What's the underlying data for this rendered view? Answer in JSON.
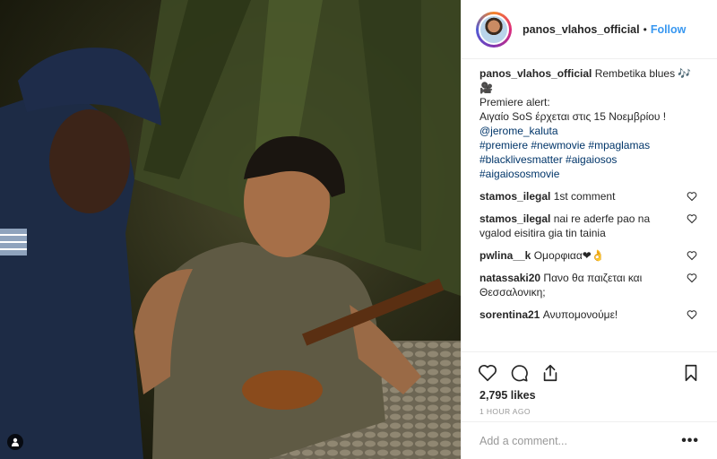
{
  "post": {
    "username": "panos_vlahos_official",
    "follow_label": "Follow",
    "separator": "•"
  },
  "caption": {
    "username": "panos_vlahos_official",
    "line1": "Rembetika blues 🎶🎥",
    "line2": "Premiere alert:",
    "line3": "Αιγαίο SoS έρχεται στις 15 Νοεμβρίου !",
    "mention": "@jerome_kaluta",
    "tags": [
      "#premiere",
      "#newmovie",
      "#mpaglamas",
      "#blacklivesmatter",
      "#aigaiosos",
      "#aigaiososmovie"
    ]
  },
  "comments": [
    {
      "user": "stamos_ilegal",
      "text": "1st comment"
    },
    {
      "user": "stamos_ilegal",
      "text": "nai re aderfe pao na vgalod eisitira gia tin tainia"
    },
    {
      "user": "pwlina__k",
      "text": "Ομορφιαα❤👌"
    },
    {
      "user": "natassaki20",
      "text": "Πανο θα παιζεται και Θεσσαλονικη;"
    },
    {
      "user": "sorentina21",
      "text": "Ανυπομονούμε!"
    }
  ],
  "stats": {
    "likes": "2,795 likes",
    "time": "1 HOUR AGO"
  },
  "composer": {
    "placeholder": "Add a comment...",
    "more": "•••"
  },
  "icons": [
    "user-tag-icon",
    "heart-icon",
    "comment-icon",
    "share-icon",
    "bookmark-icon",
    "like-comment-icon"
  ]
}
